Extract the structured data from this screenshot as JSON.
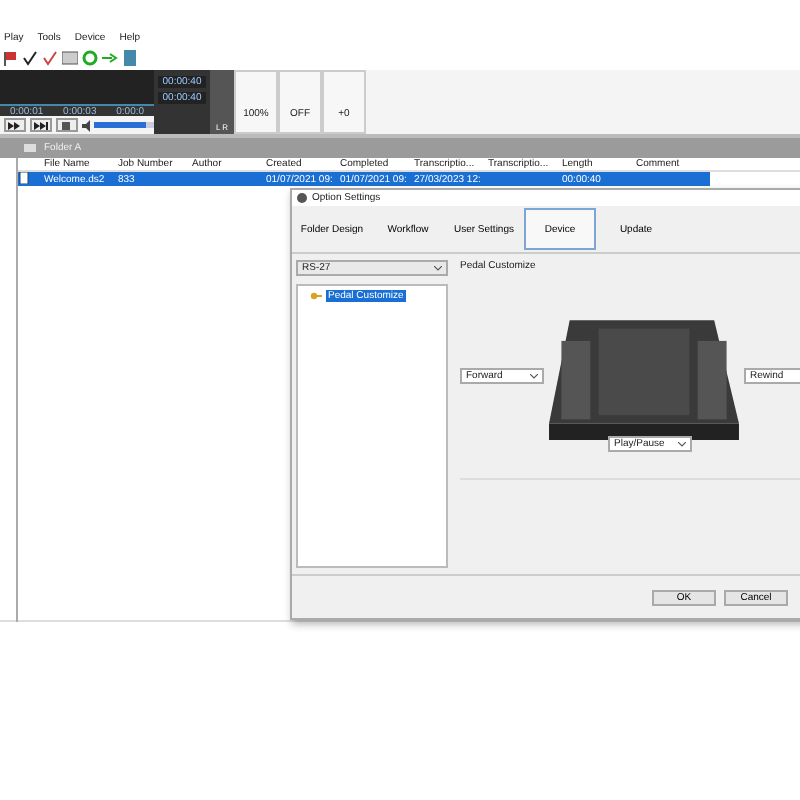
{
  "menu": [
    {
      "label": "Play"
    },
    {
      "label": "Tools"
    },
    {
      "label": "Device"
    },
    {
      "label": "Help"
    }
  ],
  "player": {
    "timeline_labels": [
      "0:00:01",
      "0:00:03",
      "0:00:0"
    ],
    "time_elapsed": "00:00:40",
    "time_total": "00:00:40",
    "meter_label": "L R",
    "controls": [
      {
        "value": "100%"
      },
      {
        "value": "OFF"
      },
      {
        "value": "+0"
      }
    ],
    "volume": {
      "level": 0.85
    }
  },
  "folder_bar": {
    "title": "Folder A"
  },
  "table": {
    "columns": [
      "File Name",
      "Job Number",
      "Author",
      "Created",
      "Completed",
      "Transcriptio...",
      "Transcriptio...",
      "Length",
      "Comment"
    ],
    "rows": [
      {
        "selected": true,
        "cells": [
          "Welcome.ds2",
          "833",
          "",
          "01/07/2021 09:",
          "01/07/2021 09:",
          "27/03/2023 12:",
          "",
          "00:00:40",
          ""
        ]
      }
    ]
  },
  "dialog": {
    "title": "Option Settings",
    "tabs": [
      {
        "label": "Folder Design",
        "selected": false
      },
      {
        "label": "Workflow",
        "selected": false
      },
      {
        "label": "User Settings",
        "selected": false
      },
      {
        "label": "Device",
        "selected": true
      },
      {
        "label": "Update",
        "selected": false
      }
    ],
    "device": "RS-27",
    "tree": [
      {
        "label": "Pedal Customize",
        "selected": true
      }
    ],
    "group_title": "Pedal Customize",
    "pedals": [
      {
        "kind": "left",
        "value": "Forward"
      },
      {
        "kind": "right",
        "value": "Rewind"
      },
      {
        "kind": "center",
        "value": "Play/Pause"
      }
    ],
    "buttons": [
      "OK",
      "Cancel"
    ]
  }
}
